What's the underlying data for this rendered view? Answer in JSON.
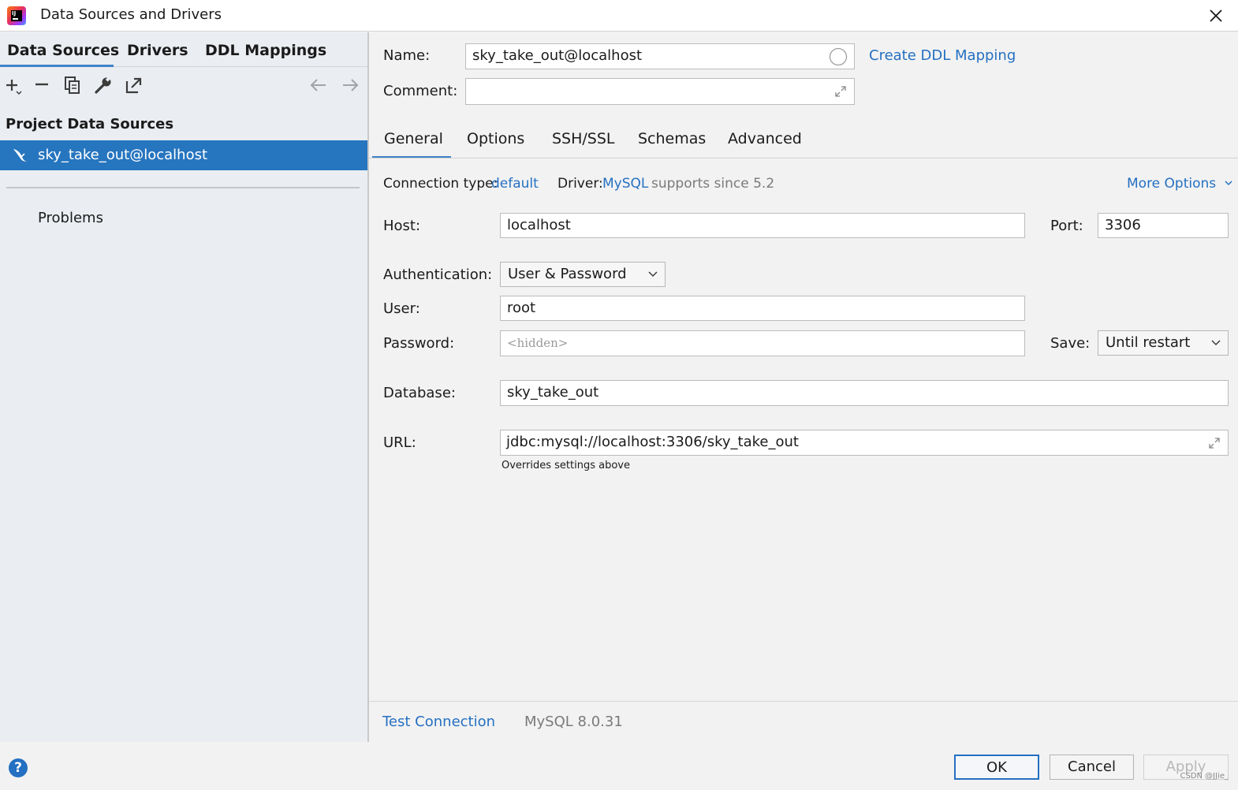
{
  "window": {
    "title": "Data Sources and Drivers"
  },
  "left_tabs": [
    {
      "label": "Data Sources"
    },
    {
      "label": "Drivers"
    },
    {
      "label": "DDL Mappings"
    }
  ],
  "left_panel": {
    "section_title": "Project Data Sources",
    "selected_source": "sky_take_out@localhost",
    "problems_label": "Problems"
  },
  "form": {
    "name_label": "Name:",
    "name_value": "sky_take_out@localhost",
    "create_ddl_link": "Create DDL Mapping",
    "comment_label": "Comment:",
    "comment_value": ""
  },
  "right_tabs": [
    {
      "label": "General"
    },
    {
      "label": "Options"
    },
    {
      "label": "SSH/SSL"
    },
    {
      "label": "Schemas"
    },
    {
      "label": "Advanced"
    }
  ],
  "general": {
    "connection_type_label": "Connection type:",
    "connection_type_value": "default",
    "driver_label": "Driver:",
    "driver_value": "MySQL",
    "driver_note": "supports since 5.2",
    "more_options": "More Options",
    "host_label": "Host:",
    "host_value": "localhost",
    "port_label": "Port:",
    "port_value": "3306",
    "auth_label": "Authentication:",
    "auth_value": "User & Password",
    "user_label": "User:",
    "user_value": "root",
    "password_label": "Password:",
    "password_placeholder": "<hidden>",
    "save_label": "Save:",
    "save_value": "Until restart",
    "database_label": "Database:",
    "database_value": "sky_take_out",
    "url_label": "URL:",
    "url_value": "jdbc:mysql://localhost:3306/sky_take_out",
    "url_hint": "Overrides settings above"
  },
  "footer": {
    "test_connection": "Test Connection",
    "server_version": "MySQL 8.0.31"
  },
  "buttons": {
    "ok": "OK",
    "cancel": "Cancel",
    "apply": "Apply"
  },
  "watermark": "CSDN @JJie_",
  "colors": {
    "accent": "#2470c2",
    "selection": "#2675bf",
    "tab_underline": "#4083c9"
  }
}
